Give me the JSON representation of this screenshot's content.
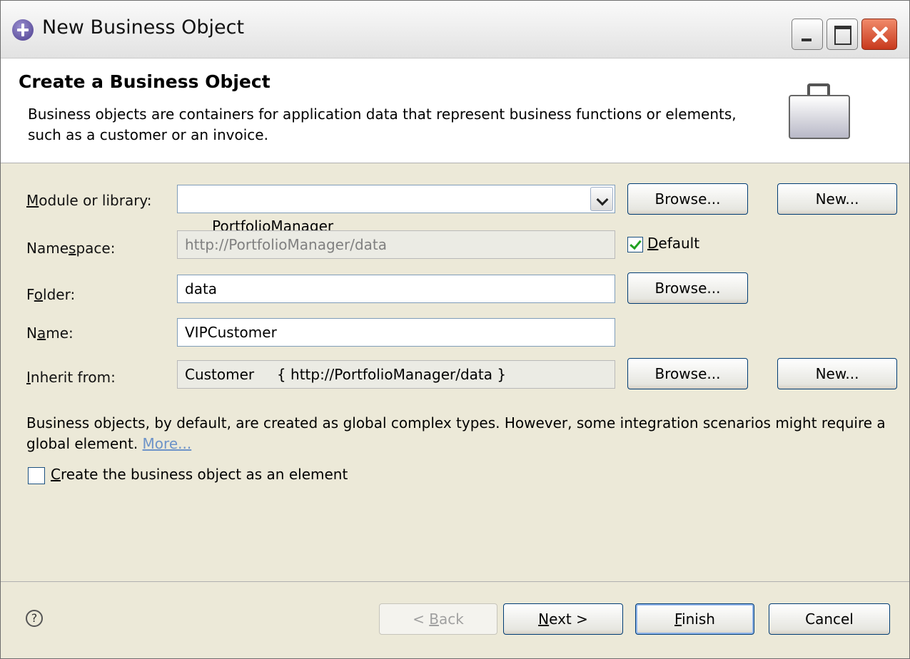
{
  "window": {
    "title": "New Business Object"
  },
  "header": {
    "title": "Create a Business Object",
    "description": "Business objects are containers for application data that represent business functions or elements, such as a customer or an invoice."
  },
  "form": {
    "module": {
      "label_pre": "",
      "label_accel": "M",
      "label_post": "odule or library:",
      "value": "PortfolioManager",
      "browse": "Browse...",
      "new": "New..."
    },
    "namespace": {
      "label_pre": "Name",
      "label_accel": "s",
      "label_post": "pace:",
      "value": "http://PortfolioManager/data",
      "default_pre": "",
      "default_accel": "D",
      "default_post": "efault",
      "default_checked": true
    },
    "folder": {
      "label_pre": "F",
      "label_accel": "o",
      "label_post": "lder:",
      "value": "data",
      "browse": "Browse..."
    },
    "name": {
      "label_pre": "N",
      "label_accel": "a",
      "label_post": "me:",
      "value": "VIPCustomer"
    },
    "inherit": {
      "label_pre": "",
      "label_accel": "I",
      "label_post": "nherit from:",
      "value": "Customer     { http://PortfolioManager/data }",
      "browse": "Browse...",
      "new": "New..."
    }
  },
  "info": {
    "text": "Business objects, by default, are created as global complex types. However, some integration scenarios might require a global element.",
    "more_link": "More..."
  },
  "element_option": {
    "label_pre": "",
    "label_accel": "C",
    "label_post": "reate the business object as an element",
    "checked": false
  },
  "footer": {
    "help_glyph": "?",
    "back": {
      "pre": "< ",
      "accel": "B",
      "post": "ack"
    },
    "next": {
      "pre": "",
      "accel": "N",
      "post": "ext >"
    },
    "finish": {
      "pre": "",
      "accel": "F",
      "post": "inish"
    },
    "cancel": "Cancel"
  }
}
